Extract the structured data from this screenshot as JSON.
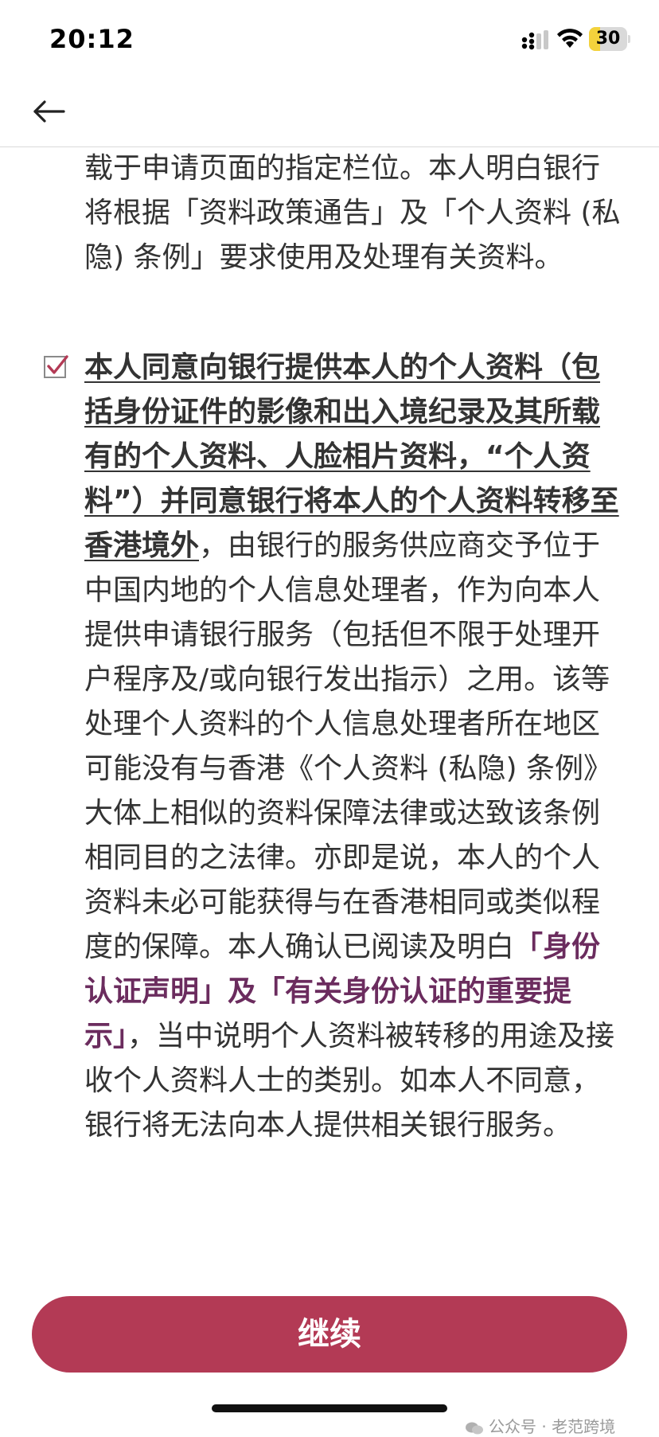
{
  "status_bar": {
    "time": "20:12",
    "battery_level": "30",
    "battery_fraction": 0.3,
    "battery_color": "#f3d23c",
    "icons": [
      "signal-icon",
      "wifi-icon",
      "battery-icon"
    ]
  },
  "nav": {
    "back_icon": "arrow-left-icon"
  },
  "consent": {
    "para1": "载于申请页面的指定栏位。本人明白银行将根据「资料政策通告」及「个人资料 (私隐) 条例」要求使用及处理有关资料。",
    "para2_underlined": "本人同意向银行提供本人的个人资料（包括身份证件的影像和出入境纪录及其所载有的个人资料、人脸相片资料，“个人资料”）并同意银行将本人的个人资料转移至香港境外",
    "para2_text1": "，由银行的服务供应商交予位于中国内地的个人信息处理者，作为向本人提供申请银行服务（包括但不限于处理开户程序及/或向银行发出指示）之用。该等处理个人资料的个人信息处理者所在地区可能没有与香港《个人资料 (私隐) 条例》大体上相似的资料保障法律或达致该条例相同目的之法律。亦即是说，本人的个人资料未必可能获得与在香港相同或类似程度的保障。本人确认已阅读及明白",
    "link1": "「身份认证声明」",
    "para2_connector": "及",
    "link2": "「有关身份认证的重要提示」",
    "para2_text2": "，当中说明个人资料被转移的用途及接收个人资料人士的类别。如本人不同意，银行将无法向本人提供相关银行服务。",
    "checkbox_checked": true,
    "checkbox_color": "#b33a55",
    "link_color": "#6b2c5e"
  },
  "footer": {
    "continue_label": "继续",
    "button_color": "#b33a55",
    "watermark": "公众号 · 老范跨境"
  }
}
